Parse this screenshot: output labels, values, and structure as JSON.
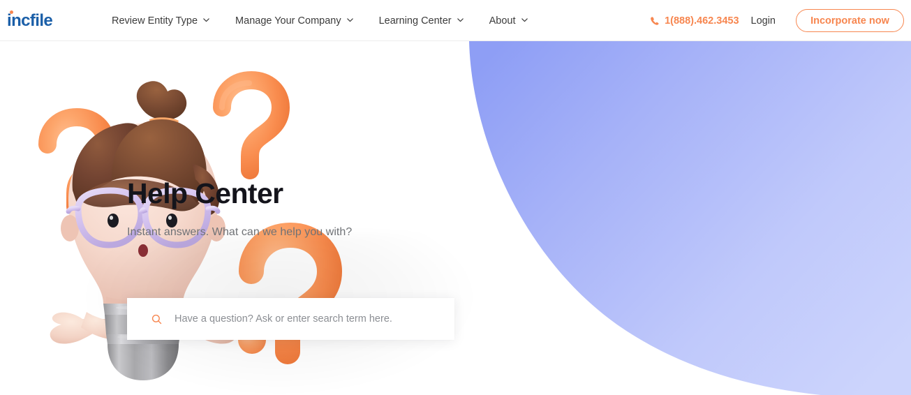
{
  "brand": {
    "logo_text": "incfile",
    "logo_color": "#1b5fa8",
    "accent_color": "#f7864f"
  },
  "nav": {
    "items": [
      {
        "label": "Review Entity Type",
        "icon": "chevron-down-icon"
      },
      {
        "label": "Manage Your Company",
        "icon": "chevron-down-icon"
      },
      {
        "label": "Learning Center",
        "icon": "chevron-down-icon"
      },
      {
        "label": "About",
        "icon": "chevron-down-icon"
      }
    ],
    "phone": {
      "icon": "phone-icon",
      "label": "1(888).462.3453"
    },
    "login_label": "Login",
    "cta_label": "Incorporate now"
  },
  "hero": {
    "title": "Help Center",
    "subtitle": "Instant answers. What can we help you with?",
    "search": {
      "icon": "search-icon",
      "value": "",
      "placeholder": "Have a question? Ask or enter search term here."
    },
    "background": {
      "blob_color_left": "#96a5f6",
      "blob_color_right": "#c8d1fc",
      "illustration": "confused-lightbulb-character-with-question-marks",
      "question_mark_color": "#fb9a5e",
      "hair_color": "#6a3f2b",
      "glasses_color": "#d6c5ee",
      "skin_color": "#f4d9cf",
      "bulb_base_color": "#9a9a9c"
    }
  }
}
